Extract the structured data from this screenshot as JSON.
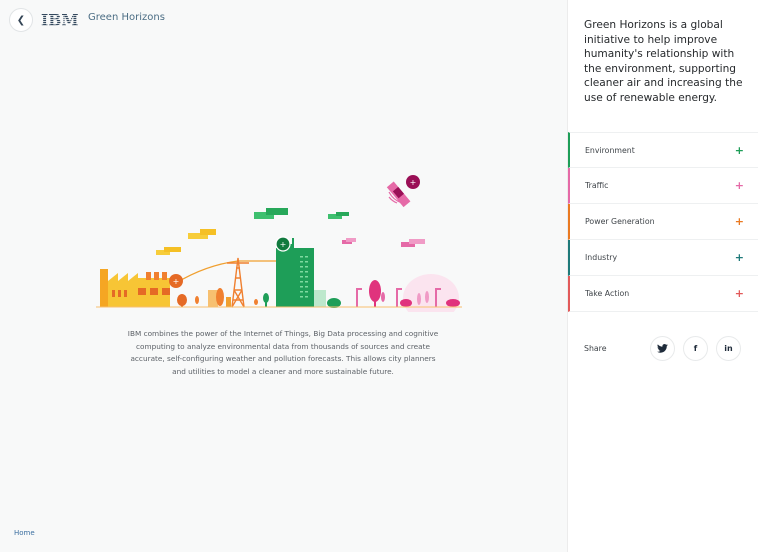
{
  "header": {
    "back_icon": "chevron-left-icon",
    "logo_text": "IBM",
    "title": "Green Horizons"
  },
  "main": {
    "description": "IBM combines the power of the Internet of Things, Big Data processing and cognitive computing to analyze environmental data from thousands of sources and create accurate, self-configuring weather and pollution forecasts. This allows city planners and utilities to model a cleaner and more sustainable future.",
    "home_link": "Home"
  },
  "sidebar": {
    "intro": "Green Horizons is a global initiative to help improve humanity's relationship with the environment, supporting cleaner air and increasing the use of renewable energy.",
    "items": [
      {
        "label": "Environment",
        "plus": "+",
        "color": "#1e9e58"
      },
      {
        "label": "Traffic",
        "plus": "+",
        "color": "#e56aa7"
      },
      {
        "label": "Power Generation",
        "plus": "+",
        "color": "#ea7a22"
      },
      {
        "label": "Industry",
        "plus": "+",
        "color": "#1f7a7a"
      },
      {
        "label": "Take Action",
        "plus": "+",
        "color": "#e25a5a"
      }
    ],
    "share": {
      "label": "Share",
      "twitter": "twitter-icon",
      "facebook": "f",
      "linkedin": "in"
    }
  }
}
